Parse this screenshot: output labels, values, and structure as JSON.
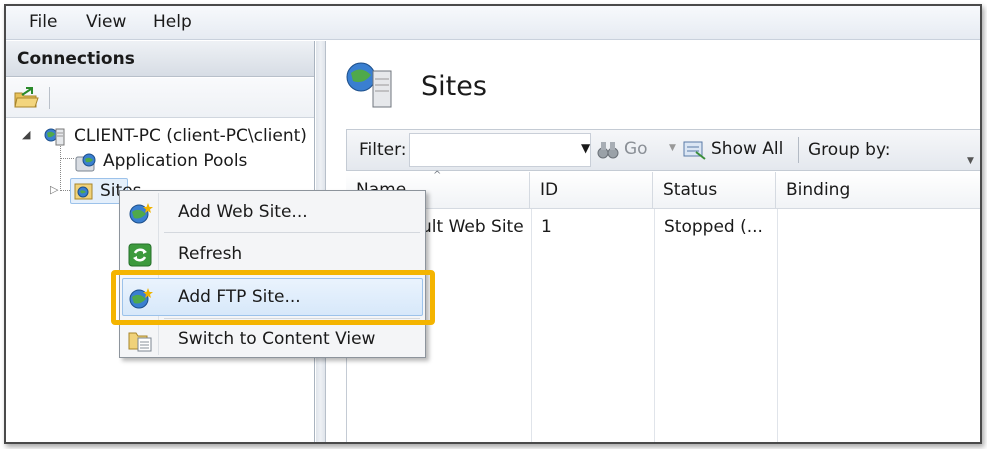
{
  "menubar": {
    "items": [
      "File",
      "View",
      "Help"
    ]
  },
  "connections": {
    "header": "Connections",
    "tree": {
      "server": "CLIENT-PC (client-PC\\client)",
      "app_pools": "Application Pools",
      "sites": "Sites"
    }
  },
  "main": {
    "title": "Sites",
    "filter": {
      "label": "Filter:",
      "value": "",
      "go_label": "Go",
      "show_all_label": "Show All",
      "group_by_label": "Group by:"
    },
    "columns": [
      "Name",
      "ID",
      "Status",
      "Binding"
    ],
    "rows": [
      {
        "name": "Default Web Site",
        "name_visible": "ult Web Site",
        "id": "1",
        "status": "Stopped (...",
        "binding": ""
      }
    ]
  },
  "context_menu": {
    "items": [
      {
        "label": "Add Web Site...",
        "icon": "globe-add-icon"
      },
      {
        "label": "Refresh",
        "icon": "refresh-icon"
      },
      {
        "label": "Add FTP Site...",
        "icon": "globe-ftp-icon",
        "highlighted": true
      },
      {
        "label": "Switch to Content View",
        "icon": "content-view-icon"
      }
    ]
  },
  "colors": {
    "highlight": "#f4b400",
    "hover_border": "#9cc2ea"
  }
}
